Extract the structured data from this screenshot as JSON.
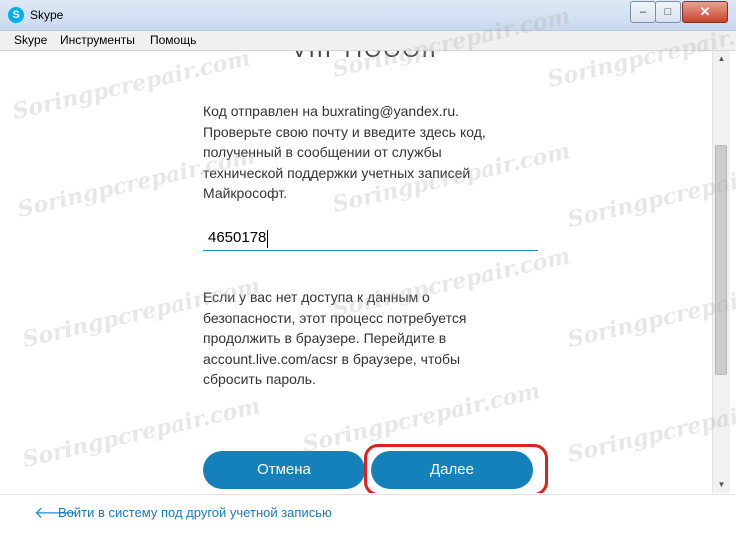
{
  "window": {
    "title": "Skype",
    "app_icon_letter": "S",
    "minimize": "–",
    "maximize": "□",
    "close": "✕"
  },
  "menu": {
    "items": [
      "Skype",
      "Инструменты",
      "Помощь"
    ]
  },
  "content": {
    "partial_header": "VIII TIOOOII",
    "message_lines": [
      "Код отправлен на buxrating@yandex.ru.",
      "Проверьте свою почту и введите здесь код,",
      "полученный в сообщении от службы",
      "технической поддержки учетных записей",
      "Майкрософт."
    ],
    "code_value": "4650178",
    "info_lines": [
      "Если у вас нет доступа к данным о",
      "безопасности, этот процесс потребуется",
      "продолжить в браузере. Перейдите в",
      "account.live.com/acsr в браузере, чтобы",
      "сбросить пароль."
    ],
    "cancel_label": "Отмена",
    "next_label": "Далее"
  },
  "footer": {
    "link_label": "Войти в систему под другой учетной записью"
  },
  "watermark": {
    "text": "Soringpcrepair.com"
  },
  "colors": {
    "accent": "#1581ba",
    "highlight": "#e01f1f",
    "link": "#1e79b5"
  }
}
